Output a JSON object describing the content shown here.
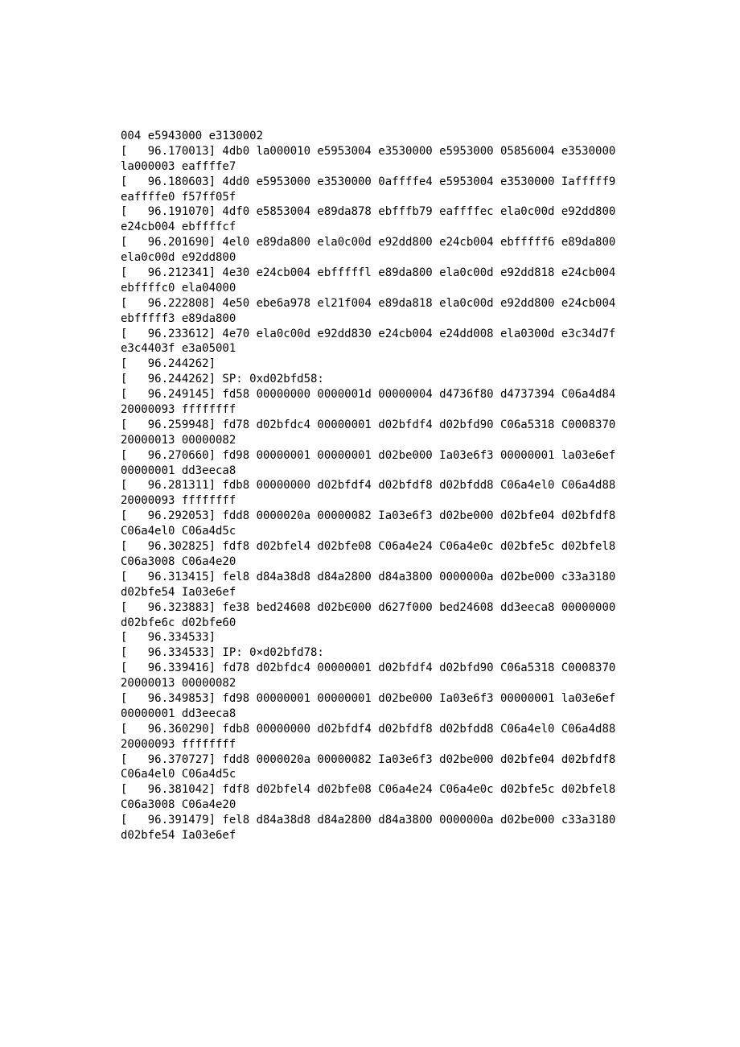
{
  "log_lines": [
    {
      "prefix": "",
      "ts": "",
      "body": "004 e5943000 e3130002"
    },
    {
      "prefix": "[   ",
      "ts": "96.170013",
      "body": "] 4db0 la000010 e5953004 e3530000 e5953000 05856004 e3530000 la000003 eaffffe7"
    },
    {
      "prefix": "[   ",
      "ts": "96.180603",
      "body": "] 4dd0 e5953000 e3530000 0affffe4 e5953004 e3530000 Iafffff9 eaffffe0 f57ff05f"
    },
    {
      "prefix": "[   ",
      "ts": "96.191070",
      "body": "] 4df0 e5853004 e89da878 ebfffb79 eaffffec ela0c00d e92dd800 e24cb004 ebffffcf"
    },
    {
      "prefix": "[   ",
      "ts": "96.201690",
      "body": "] 4el0 e89da800 ela0c00d e92dd800 e24cb004 ebfffff6 e89da800 ela0c00d e92dd800"
    },
    {
      "prefix": "[   ",
      "ts": "96.212341",
      "body": "] 4e30 e24cb004 ebfffffl e89da800 ela0c00d e92dd818 e24cb004 ebffffc0 ela04000"
    },
    {
      "prefix": "[   ",
      "ts": "96.222808",
      "body": "] 4e50 ebe6a978 el21f004 e89da818 ela0c00d e92dd800 e24cb004 ebfffff3 e89da800"
    },
    {
      "prefix": "[   ",
      "ts": "96.233612",
      "body": "] 4e70 ela0c00d e92dd830 e24cb004 e24dd008 ela0300d e3c34d7f e3c4403f e3a05001"
    },
    {
      "prefix": "[   ",
      "ts": "96.244262",
      "body": "]"
    },
    {
      "prefix": "[   ",
      "ts": "96.244262",
      "body": "] SP: 0xd02bfd58:"
    },
    {
      "prefix": "[   ",
      "ts": "96.249145",
      "body": "] fd58 00000000 0000001d 00000004 d4736f80 d4737394 C06a4d84 20000093 ffffffff"
    },
    {
      "prefix": "[   ",
      "ts": "96.259948",
      "body": "] fd78 d02bfdc4 00000001 d02bfdf4 d02bfd90 C06a5318 C0008370 20000013 00000082"
    },
    {
      "prefix": "[   ",
      "ts": "96.270660",
      "body": "] fd98 00000001 00000001 d02be000 Ia03e6f3 00000001 la03e6ef 00000001 dd3eeca8"
    },
    {
      "prefix": "[   ",
      "ts": "96.281311",
      "body": "] fdb8 00000000 d02bfdf4 d02bfdf8 d02bfdd8 C06a4el0 C06a4d88 20000093 ffffffff"
    },
    {
      "prefix": "[   ",
      "ts": "96.292053",
      "body": "] fdd8 0000020a 00000082 Ia03e6f3 d02be000 d02bfe04 d02bfdf8 C06a4el0 C06a4d5c"
    },
    {
      "prefix": "[   ",
      "ts": "96.302825",
      "body": "] fdf8 d02bfel4 d02bfe08 C06a4e24 C06a4e0c d02bfe5c d02bfel8 C06a3008 C06a4e20"
    },
    {
      "prefix": "[   ",
      "ts": "96.313415",
      "body": "] fel8 d84a38d8 d84a2800 d84a3800 0000000a d02be000 c33a3180 d02bfe54 Ia03e6ef"
    },
    {
      "prefix": "[   ",
      "ts": "96.323883",
      "body": "] fe38 bed24608 d02b∈000 d627f000 bed24608 dd3eeca8 00000000 d02bfe6c d02bfe60"
    },
    {
      "prefix": "[   ",
      "ts": "96.334533",
      "body": "]"
    },
    {
      "prefix": "[   ",
      "ts": "96.334533",
      "body": "] IP: 0×d02bfd78:"
    },
    {
      "prefix": "[   ",
      "ts": "96.339416",
      "body": "] fd78 d02bfdc4 00000001 d02bfdf4 d02bfd90 C06a5318 C0008370 20000013 00000082"
    },
    {
      "prefix": "[   ",
      "ts": "96.349853",
      "body": "] fd98 00000001 00000001 d02be000 Ia03e6f3 00000001 la03e6ef 00000001 dd3eeca8"
    },
    {
      "prefix": "[   ",
      "ts": "96.360290",
      "body": "] fdb8 00000000 d02bfdf4 d02bfdf8 d02bfdd8 C06a4el0 C06a4d88 20000093 ffffffff"
    },
    {
      "prefix": "[   ",
      "ts": "96.370727",
      "body": "] fdd8 0000020a 00000082 Ia03e6f3 d02be000 d02bfe04 d02bfdf8 C06a4el0 C06a4d5c"
    },
    {
      "prefix": "[   ",
      "ts": "96.381042",
      "body": "] fdf8 d02bfel4 d02bfe08 C06a4e24 C06a4e0c d02bfe5c d02bfel8 C06a3008 C06a4e20"
    },
    {
      "prefix": "[   ",
      "ts": "96.391479",
      "body": "] fel8 d84a38d8 d84a2800 d84a3800 0000000a d02be000 c33a3180 d02bfe54 Ia03e6ef"
    }
  ]
}
